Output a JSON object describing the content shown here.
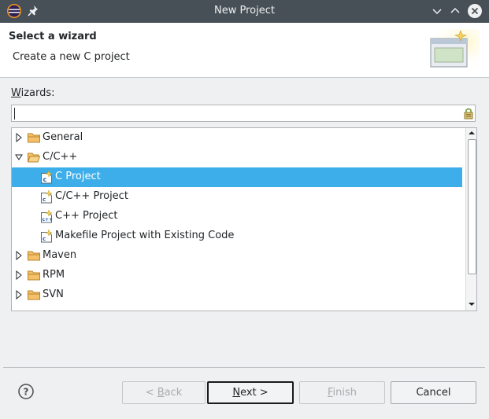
{
  "window": {
    "title": "New Project"
  },
  "header": {
    "title": "Select a wizard",
    "description": "Create a new C project"
  },
  "wizards_label": {
    "mnemonic": "W",
    "rest": "izards:"
  },
  "filter": {
    "value": ""
  },
  "tree": [
    {
      "label": "General",
      "expanded": false
    },
    {
      "label": "C/C++",
      "expanded": true
    },
    {
      "label": "C Project",
      "selected": true,
      "icon": "c-project-icon"
    },
    {
      "label": "C/C++ Project",
      "icon": "cpp-project-icon"
    },
    {
      "label": "C++ Project",
      "icon": "cplusplus-project-icon"
    },
    {
      "label": "Makefile Project with Existing Code",
      "icon": "makefile-project-icon"
    },
    {
      "label": "Maven",
      "expanded": false
    },
    {
      "label": "RPM",
      "expanded": false
    },
    {
      "label": "SVN",
      "expanded": false
    }
  ],
  "buttons": {
    "back": {
      "pre": "< ",
      "mnemonic": "B",
      "post": "ack"
    },
    "next": {
      "mnemonic": "N",
      "post": "ext >"
    },
    "finish": {
      "mnemonic": "F",
      "post": "inish"
    },
    "cancel": "Cancel"
  },
  "colors": {
    "titlebar": "#475057",
    "selection": "#3daee9",
    "folder": "#e8a742"
  }
}
